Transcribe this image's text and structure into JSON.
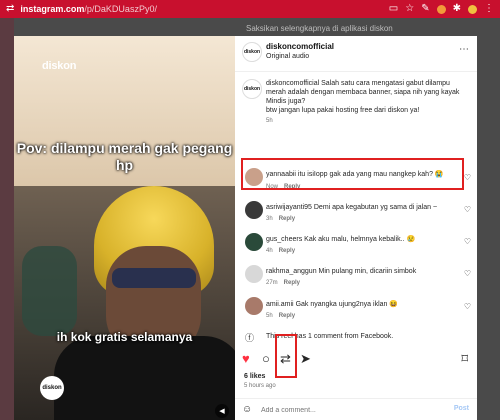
{
  "browser": {
    "url_domain": "instagram.com",
    "url_path": "/p/DaKDUaszPy0/",
    "backdrop_text": "Saksikan selengkapnya di aplikasi diskon"
  },
  "media": {
    "logo": "diskon",
    "caption_top": "Pov: dilampu merah gak pegang hp",
    "caption_bottom": "ih kok gratis selamanya",
    "avatar_text": "diskon"
  },
  "header": {
    "username": "diskoncomofficial",
    "subtitle": "Original audio",
    "avatar_text": "diskon"
  },
  "post_caption": {
    "username": "diskoncomofficial",
    "text": "Salah satu cara mengatasi gabut dilampu merah adalah dengan membaca banner, siapa nih yang kayak Mindis juga?",
    "line2": "btw jangan lupa pakai hosting free dari diskon ya!",
    "time": "5h"
  },
  "comments": [
    {
      "username": "yannaabii",
      "text": "itu isiIopp gak ada yang mau nangkep kah? 😭",
      "time": "Now",
      "reply": "Reply",
      "avatar_color": "#c9a08a"
    },
    {
      "username": "asriwijayanti95",
      "text": "Demi apa kegabutan yg sama di jalan ~",
      "time": "3h",
      "reply": "Reply",
      "avatar_color": "#3a3a3a"
    },
    {
      "username": "gus_cheers",
      "text": "Kak aku malu, helmnya kebalik.. 😢",
      "time": "4h",
      "reply": "Reply",
      "avatar_color": "#2a4a3a"
    },
    {
      "username": "rakhma_anggun",
      "text": "Min pulang min, dicariin simbok",
      "time": "27m",
      "reply": "Reply",
      "avatar_color": "#d8d8d8"
    },
    {
      "username": "amii.amii",
      "text": "Gak nyangka ujung2nya iklan 😆",
      "time": "5h",
      "reply": "Reply",
      "avatar_color": "#a87a6a"
    }
  ],
  "facebook_note": "This reel has 1 comment from Facebook.",
  "footer": {
    "likes": "6 likes",
    "time": "5 hours ago",
    "comment_placeholder": "Add a comment...",
    "post_label": "Post"
  },
  "colors": {
    "accent_red": "#e02020",
    "browser_red": "#c8102e",
    "like_red": "#ff3040",
    "post_blue": "#a5c8f5"
  }
}
